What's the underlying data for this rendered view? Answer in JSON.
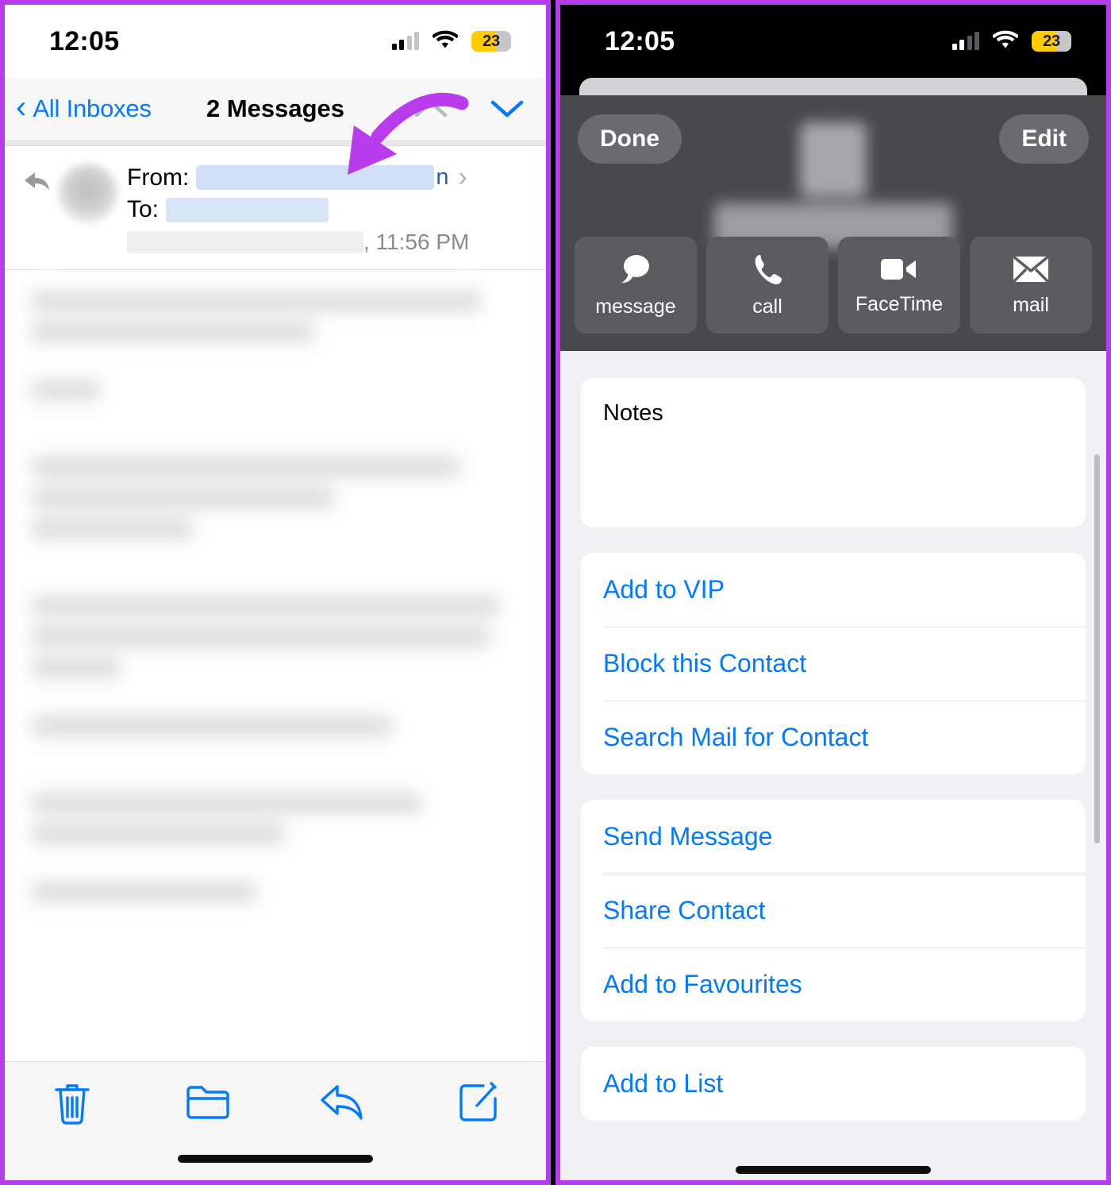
{
  "accent": {
    "ios_blue": "#027aff",
    "annotation_purple": "#b83bec",
    "battery_yellow": "#ffcc00",
    "redaction_blue": "#cfe0f7"
  },
  "left_panel": {
    "status_bar": {
      "time": "12:05",
      "battery_percent": "23",
      "signal_icon": "cellular-bars-icon",
      "wifi_icon": "wifi-icon",
      "battery_icon": "battery-icon"
    },
    "nav": {
      "back_label": "All Inboxes",
      "back_icon": "chevron-left-icon",
      "title": "2 Messages",
      "prev_icon": "chevron-up-icon",
      "next_icon": "chevron-down-icon"
    },
    "message_header": {
      "reply_icon": "reply-arrow-icon",
      "avatar": "contact-avatar",
      "from_label": "From:",
      "from_value": "",
      "from_tail": "n",
      "to_label": "To:",
      "to_value": "",
      "disclosure_icon": "chevron-right-icon",
      "date_value": "",
      "time_value": ", 11:56 PM"
    },
    "body": {
      "content": "",
      "state": "blurred"
    },
    "toolbar": [
      {
        "name": "trash-icon",
        "label": "Delete"
      },
      {
        "name": "folder-icon",
        "label": "Move"
      },
      {
        "name": "reply-icon",
        "label": "Reply"
      },
      {
        "name": "compose-icon",
        "label": "Compose"
      }
    ]
  },
  "right_panel": {
    "status_bar": {
      "time": "12:05",
      "battery_percent": "23",
      "signal_icon": "cellular-bars-icon",
      "wifi_icon": "wifi-icon",
      "battery_icon": "battery-icon"
    },
    "hero": {
      "done_label": "Done",
      "edit_label": "Edit",
      "contact_name": "",
      "contact_avatar": "contact-photo",
      "quick_actions": [
        {
          "label": "message",
          "icon": "message-bubble-icon"
        },
        {
          "label": "call",
          "icon": "phone-icon"
        },
        {
          "label": "FaceTime",
          "icon": "video-camera-icon"
        },
        {
          "label": "mail",
          "icon": "envelope-icon"
        }
      ]
    },
    "notes": {
      "title": "Notes",
      "value": ""
    },
    "groups": [
      {
        "id": "mail-actions",
        "rows": [
          "Add to VIP",
          "Block this Contact",
          "Search Mail for Contact"
        ]
      },
      {
        "id": "contact-actions",
        "rows": [
          "Send Message",
          "Share Contact",
          "Add to Favourites"
        ]
      },
      {
        "id": "list-actions",
        "rows": [
          "Add to List"
        ]
      }
    ]
  },
  "annotations": [
    {
      "id": "arrow-to-sender",
      "type": "curved-arrow",
      "points_to": "From field"
    },
    {
      "id": "arrow-to-block",
      "type": "curved-arrow",
      "points_to": "Block this Contact"
    }
  ]
}
